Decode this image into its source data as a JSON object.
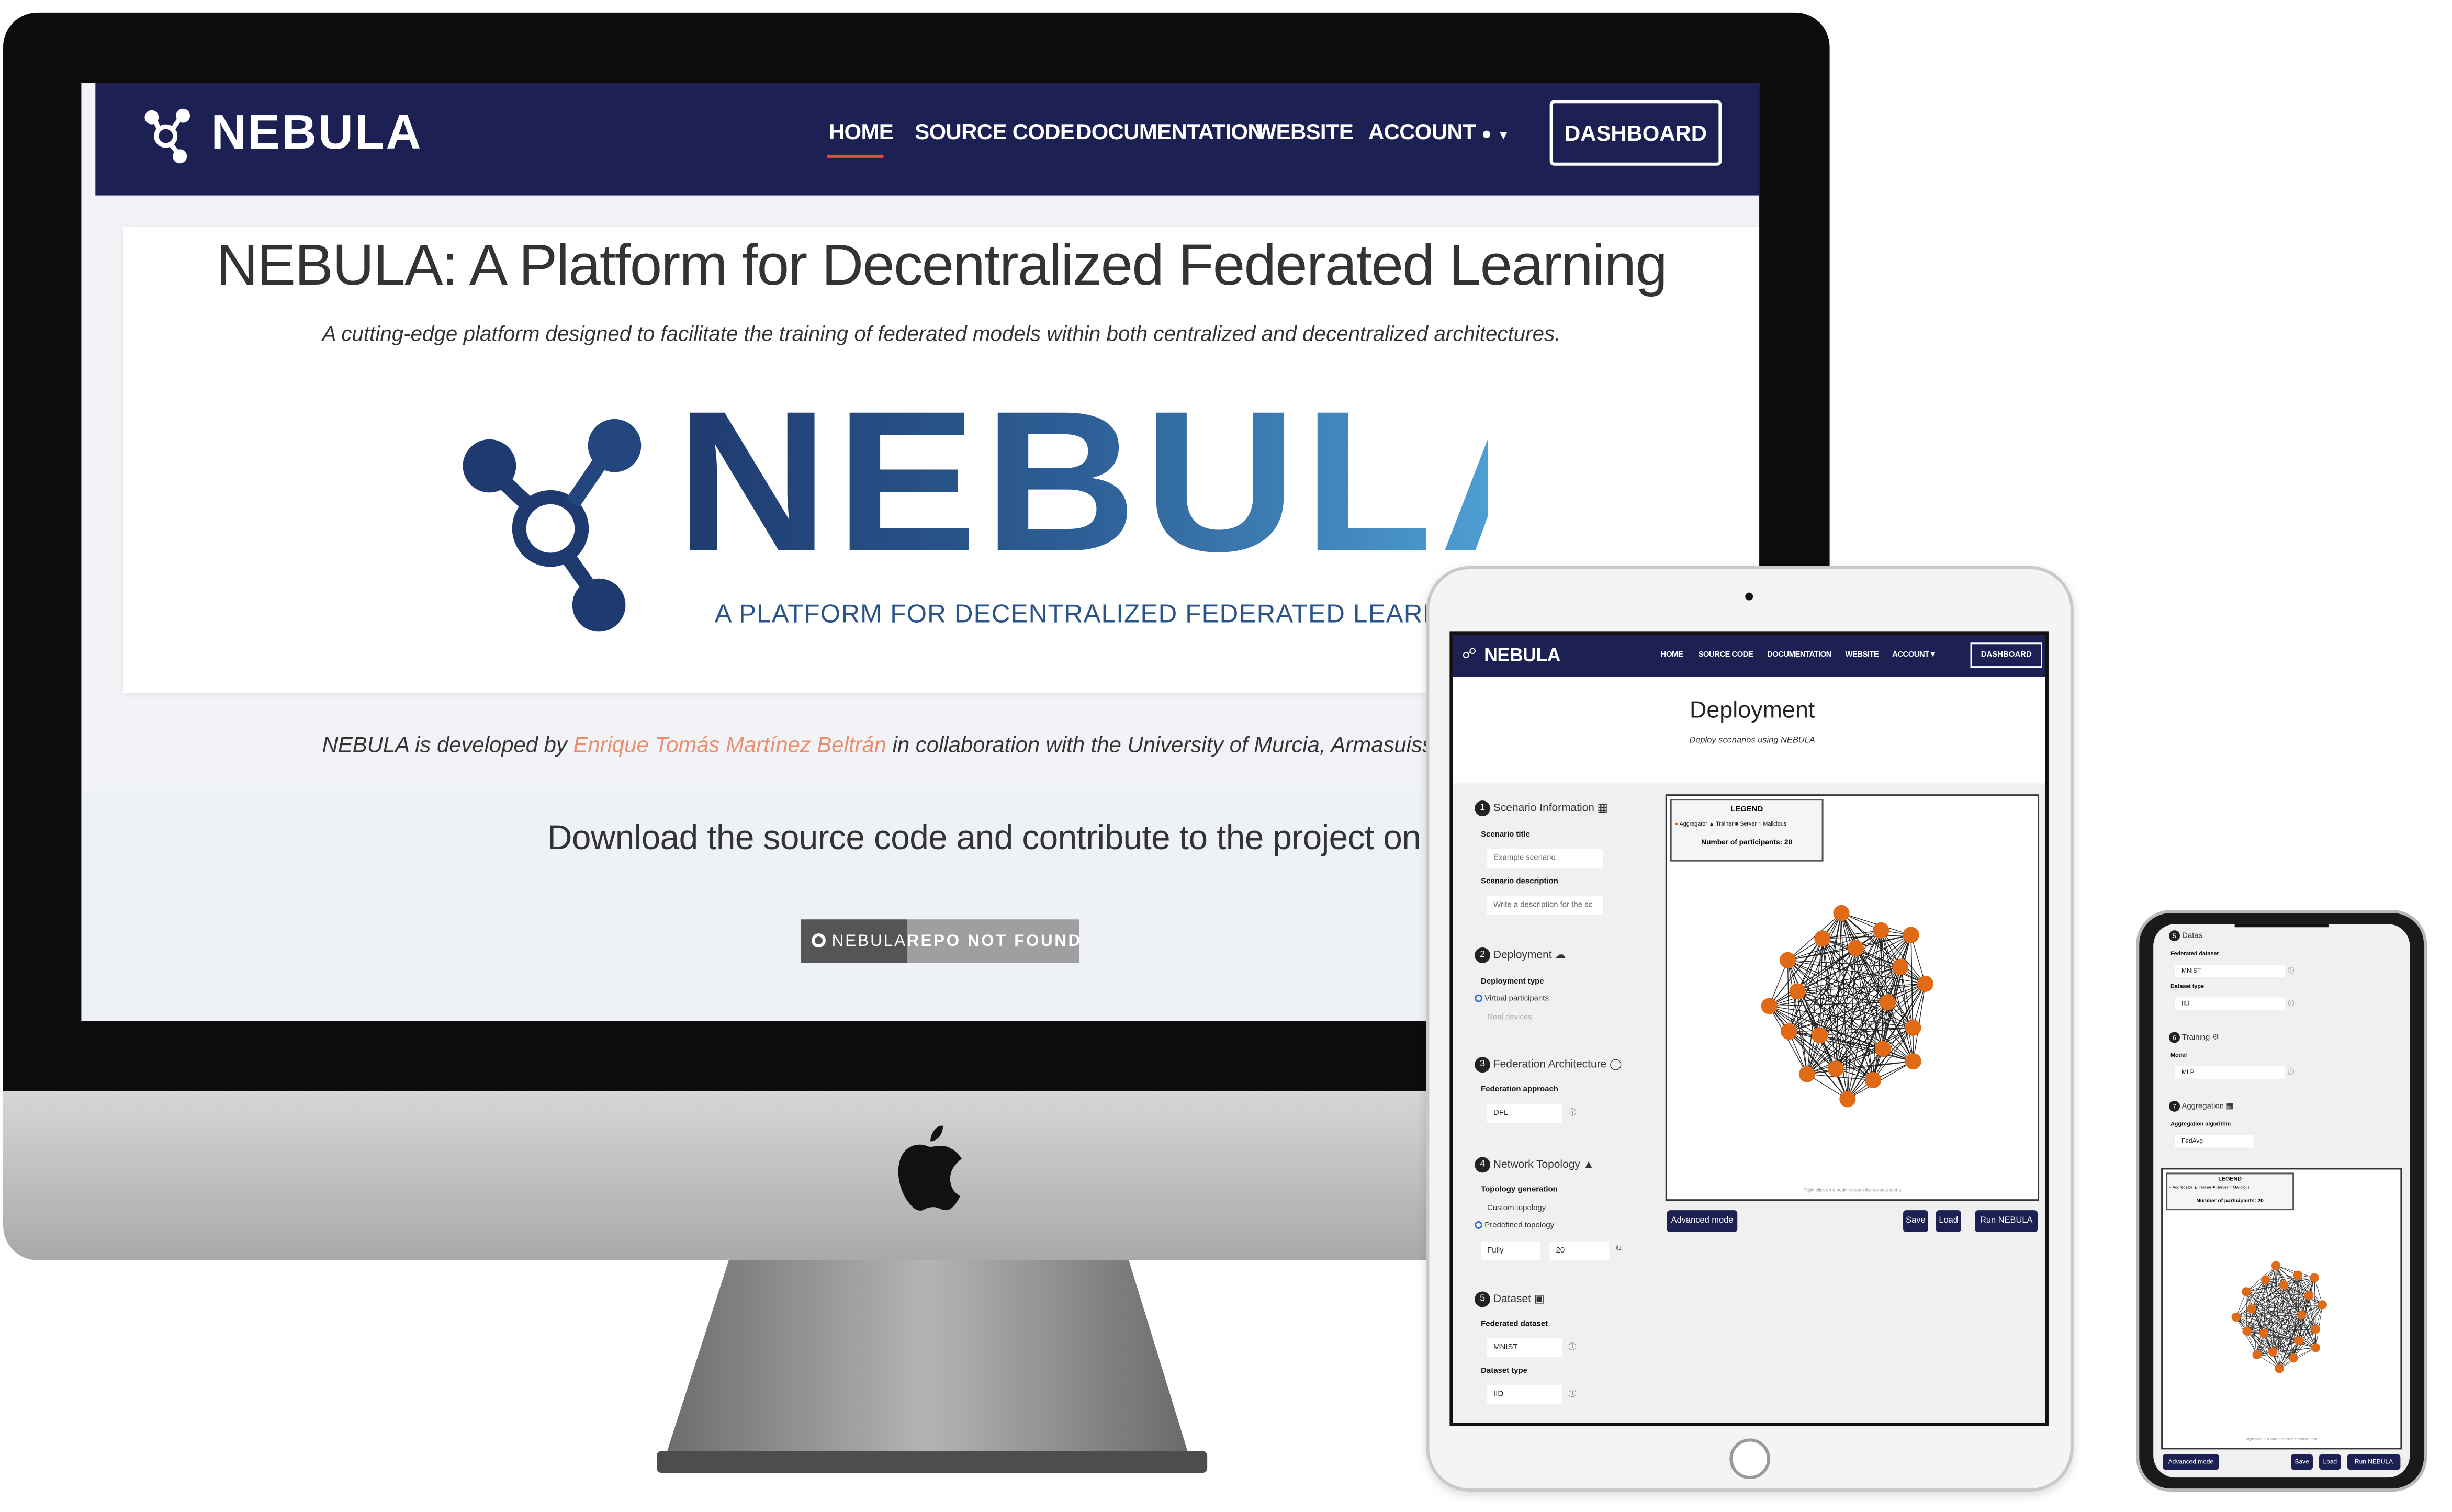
{
  "brand": {
    "name": "NEBULA"
  },
  "colors": {
    "navy": "#1d2052",
    "accent_link": "#e98e6d",
    "node_orange": "#e06a16",
    "logo_blue_dark": "#1f3a6e",
    "logo_blue_light": "#4a9ad0"
  },
  "nav": {
    "items": [
      "HOME",
      "SOURCE CODE",
      "DOCUMENTATION",
      "WEBSITE",
      "ACCOUNT"
    ],
    "active": "HOME",
    "dashboard": "DASHBOARD"
  },
  "desktop": {
    "hero_title": "NEBULA: A Platform for Decentralized Federated Learning",
    "hero_subtitle": "A cutting-edge platform designed to facilitate the training of federated models within both centralized and decentralized architectures.",
    "logo_text": "NEBULA",
    "logo_tagline": "A PLATFORM FOR DECENTRALIZED FEDERATED LEARNING",
    "dev_prefix": "NEBULA is developed by ",
    "dev_author": "Enrique Tomás Martínez Beltrán",
    "dev_suffix": " in collaboration with the University of Murcia, Armasuisse, and the Univ",
    "download_text": "Download the source code and contribute to the project on",
    "badge_left": "NEBULA",
    "badge_right": "REPO NOT FOUND"
  },
  "tablet": {
    "title": "Deployment",
    "subtitle": "Deploy scenarios using NEBULA",
    "sections": [
      {
        "num": "1",
        "title": "Scenario Information"
      },
      {
        "num": "2",
        "title": "Deployment"
      },
      {
        "num": "3",
        "title": "Federation Architecture"
      },
      {
        "num": "4",
        "title": "Network Topology"
      },
      {
        "num": "5",
        "title": "Dataset"
      }
    ],
    "scenario_title_label": "Scenario title",
    "scenario_title_placeholder": "Example scenario",
    "scenario_desc_label": "Scenario description",
    "scenario_desc_placeholder": "Write a description for the sc",
    "deployment_type_label": "Deployment type",
    "deployment_opt1": "Virtual participants",
    "deployment_opt2": "Real devices",
    "federation_label": "Federation approach",
    "federation_value": "DFL",
    "topology_label": "Topology generation",
    "topology_opt1": "Custom topology",
    "topology_opt2": "Predefined topology",
    "topology_value": "Fully",
    "topology_count": "20",
    "dataset_label": "Federated dataset",
    "dataset_value": "MNIST",
    "dataset_type_label": "Dataset type",
    "dataset_type_value": "IID",
    "legend_title": "LEGEND",
    "legend_items": [
      "Aggregator",
      "Trainer",
      "Server",
      "Malicious"
    ],
    "participants": "Number of participants: 20",
    "hint": "Right click on a node to open the context menu",
    "btn_advanced": "Advanced mode",
    "btn_save": "Save",
    "btn_load": "Load",
    "btn_run": "Run NEBULA"
  },
  "phone": {
    "sections": [
      {
        "num": "5",
        "title": "Datas"
      },
      {
        "num": "6",
        "title": "Training"
      },
      {
        "num": "7",
        "title": "Aggregation"
      }
    ],
    "dataset_label": "Federated dataset",
    "dataset_value": "MNIST",
    "dataset_type_label": "Dataset type",
    "dataset_type_value": "IID",
    "model_label": "Model",
    "model_value": "MLP",
    "agg_label": "Aggregation algorithm",
    "agg_value": "FedAvg",
    "legend_title": "LEGEND",
    "legend_items": [
      "Aggregator",
      "Trainer",
      "Server",
      "Malicious"
    ],
    "participants": "Number of participants: 20",
    "hint": "Right click on a node to open the context menu",
    "btn_advanced": "Advanced mode",
    "btn_save": "Save",
    "btn_load": "Load",
    "btn_run": "Run NEBULA"
  }
}
